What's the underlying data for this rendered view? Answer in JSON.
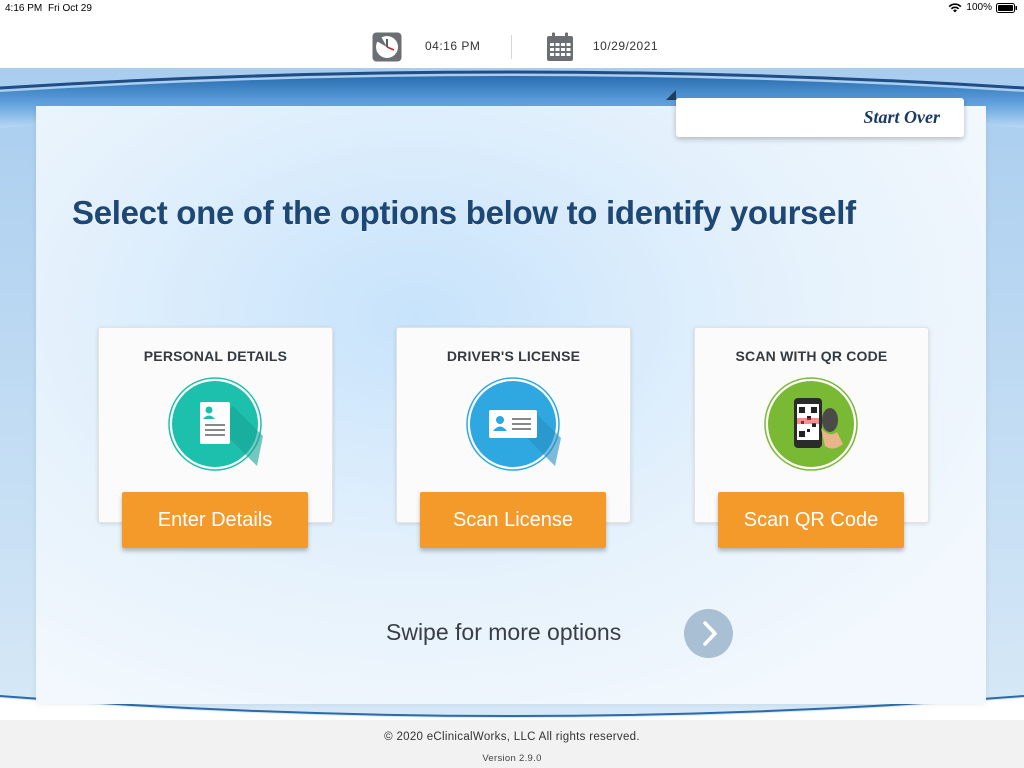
{
  "status_bar": {
    "time": "4:16 PM",
    "date": "Fri Oct 29",
    "battery": "100%"
  },
  "header": {
    "time": "04:16 PM",
    "date": "10/29/2021"
  },
  "start_over_label": "Start Over",
  "page_title": "Select one of the options below to identify yourself",
  "options": [
    {
      "title": "PERSONAL DETAILS",
      "button": "Enter Details",
      "icon": "personal-details-icon",
      "color": "#1dbfad"
    },
    {
      "title": "DRIVER'S LICENSE",
      "button": "Scan License",
      "icon": "drivers-license-icon",
      "color": "#2fa8e2"
    },
    {
      "title": "SCAN WITH QR CODE",
      "button": "Scan QR Code",
      "icon": "qr-code-scan-icon",
      "color": "#7ab933"
    }
  ],
  "swipe_text": "Swipe for more options",
  "footer": {
    "copyright": "© 2020 eClinicalWorks, LLC All rights reserved.",
    "version": "Version 2.9.0"
  },
  "colors": {
    "accent_button": "#f39a2b",
    "title": "#1d4774",
    "swipe_arrow": "#a9c0d4"
  }
}
